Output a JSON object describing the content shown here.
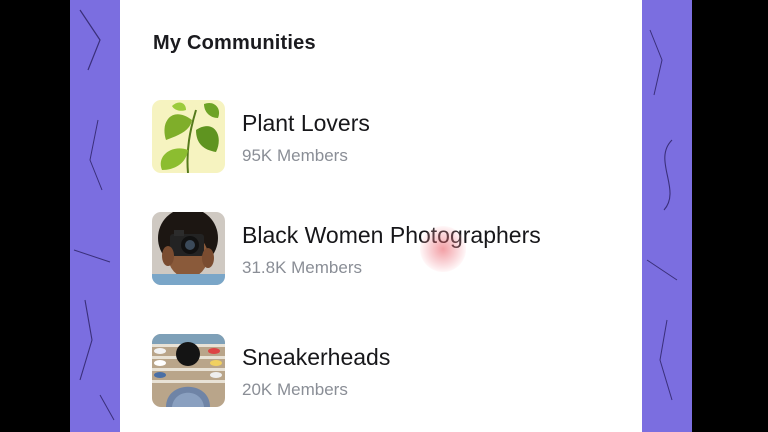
{
  "section": {
    "title": "My Communities"
  },
  "communities": [
    {
      "name": "Plant Lovers",
      "members": "95K Members",
      "icon": "plant-leaves-image"
    },
    {
      "name": "Black Women Photographers",
      "members": "31.8K Members",
      "icon": "photographer-camera-image"
    },
    {
      "name": "Sneakerheads",
      "members": "20K Members",
      "icon": "sneaker-wall-image"
    }
  ],
  "colors": {
    "background_accent": "#7b6ee0",
    "card": "#ffffff",
    "title_text": "#1b1b1f",
    "secondary_text": "#8a8e96",
    "tap_highlight": "#e8505a"
  }
}
